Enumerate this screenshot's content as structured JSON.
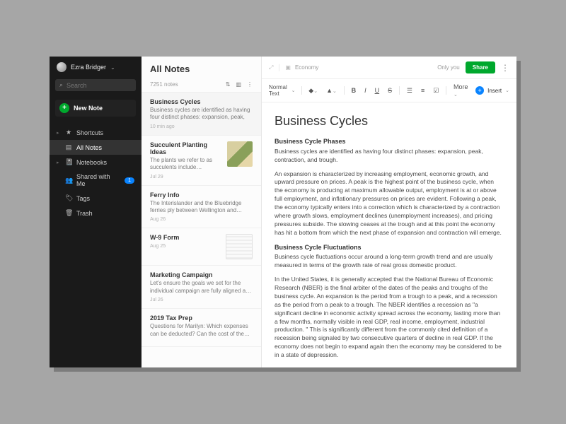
{
  "user": {
    "name": "Ezra Bridger"
  },
  "search": {
    "placeholder": "Search"
  },
  "sidebar": {
    "new_note": "New Note",
    "items": [
      {
        "label": "Shortcuts",
        "icon": "★",
        "caret": true
      },
      {
        "label": "All Notes",
        "icon": "▤",
        "active": true
      },
      {
        "label": "Notebooks",
        "icon": "📓",
        "caret": true
      },
      {
        "label": "Shared with Me",
        "icon": "👥",
        "badge": "1"
      },
      {
        "label": "Tags",
        "icon": "🏷"
      },
      {
        "label": "Trash",
        "icon": "🗑"
      }
    ]
  },
  "list": {
    "title": "All Notes",
    "count": "7251 notes",
    "notes": [
      {
        "title": "Business Cycles",
        "snippet": "Business cycles are identified as having four distinct phases: expansion, peak,",
        "date": "10 min ago",
        "active": true
      },
      {
        "title": "Succulent Planting Ideas",
        "snippet": "The plants we refer to as succulents include sempervi...",
        "date": "Jul 29",
        "thumb": "photo"
      },
      {
        "title": "Ferry Info",
        "snippet": "The Interislander and the Bluebridge ferries ply between Wellington and Newfoundland.",
        "date": "Aug 26"
      },
      {
        "title": "W-9 Form",
        "snippet": "",
        "date": "Aug 25",
        "thumb": "doc"
      },
      {
        "title": "Marketing Campaign",
        "snippet": "Let's ensure the goals we set for the individual campaign are fully aligned and in",
        "date": "Jul 26"
      },
      {
        "title": "2019 Tax Prep",
        "snippet": "Questions for Marilyn: Which expenses can be deducted? Can the cost of the NAO...",
        "date": ""
      }
    ]
  },
  "editor": {
    "breadcrumb": {
      "notebook": "Economy"
    },
    "visibility": "Only you",
    "share": "Share",
    "toolbar": {
      "style": "Normal Text",
      "more": "More",
      "insert": "Insert"
    },
    "title": "Business Cycles",
    "sections": [
      {
        "heading": "Business Cycle Phases",
        "paras": [
          "Business cycles are identified as having four distinct phases: expansion, peak, contraction, and trough.",
          "An expansion is characterized by increasing employment, economic growth, and upward pressure on prices. A peak is the highest point of the business cycle, when the economy is producing at maximum allowable output, employment is at or above full employment, and inflationary pressures on prices are evident. Following a peak, the economy typically enters into a correction which is characterized by a contraction where growth slows, employment declines (unemployment increases), and pricing pressures subside.  The slowing ceases at the trough and at this point the economy has hit a bottom from which the next phase of expansion and contraction will emerge."
        ]
      },
      {
        "heading": "Business Cycle Fluctuations",
        "paras": [
          "Business cycle fluctuations occur around a long-term growth trend and are usually measured in terms of the growth rate of real gross domestic product.",
          "In the United States, it is generally accepted that the National Bureau of Economic Research (NBER) is the final arbiter of the dates of the peaks and troughs of the business cycle. An expansion is the period from a trough to a peak, and a recession as the period from a peak to a trough. The NBER identifies a recession as \"a significant decline in economic activity spread across the economy, lasting more than a few months, normally visible in real GDP, real income, employment, industrial production. \" This is significantly different from the commonly cited definition of a recession being signaled by two consecutive quarters of decline in real GDP.  If the economy does not begin to expand again then the economy may be considered to be in a state of depression."
        ]
      }
    ]
  }
}
